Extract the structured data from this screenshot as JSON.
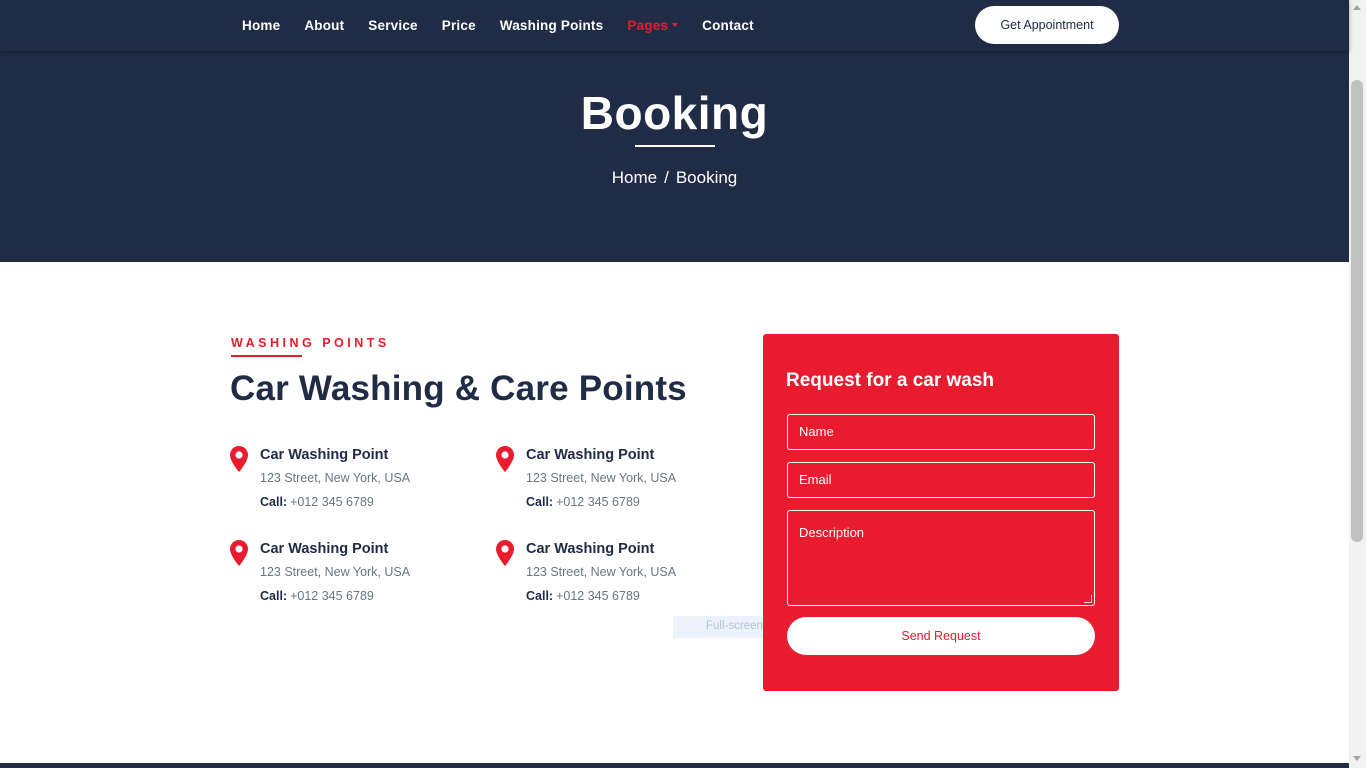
{
  "nav": {
    "links": [
      {
        "label": "Home"
      },
      {
        "label": "About"
      },
      {
        "label": "Service"
      },
      {
        "label": "Price"
      },
      {
        "label": "Washing Points"
      },
      {
        "label": "Pages"
      },
      {
        "label": "Contact"
      }
    ],
    "active_link": "Pages",
    "cta_label": "Get Appointment"
  },
  "hero": {
    "title": "Booking",
    "breadcrumb": [
      "Home",
      "Booking"
    ],
    "breadcrumb_separator": "/"
  },
  "section": {
    "label": "WASHING POINTS",
    "title": "Car Washing & Care Points"
  },
  "points": [
    {
      "title": "Car Washing Point",
      "address": "123 Street, New York, USA",
      "call_label": "Call:",
      "phone": "+012 345 6789",
      "icon": "map-marker-icon"
    },
    {
      "title": "Car Washing Point",
      "address": "123 Street, New York, USA",
      "call_label": "Call:",
      "phone": "+012 345 6789",
      "icon": "map-marker-icon"
    },
    {
      "title": "Car Washing Point",
      "address": "123 Street, New York, USA",
      "call_label": "Call:",
      "phone": "+012 345 6789",
      "icon": "map-marker-icon"
    },
    {
      "title": "Car Washing Point",
      "address": "123 Street, New York, USA",
      "call_label": "Call:",
      "phone": "+012 345 6789",
      "icon": "map-marker-icon"
    }
  ],
  "form": {
    "title": "Request for a car wash",
    "name_placeholder": "Name",
    "email_placeholder": "Email",
    "description_placeholder": "Description",
    "submit_label": "Send Request"
  },
  "overlay": {
    "text": "Full-screen Snip"
  },
  "colors": {
    "navy": "#202c45",
    "accent": "#e81c2e",
    "text_muted": "#6c757d"
  }
}
